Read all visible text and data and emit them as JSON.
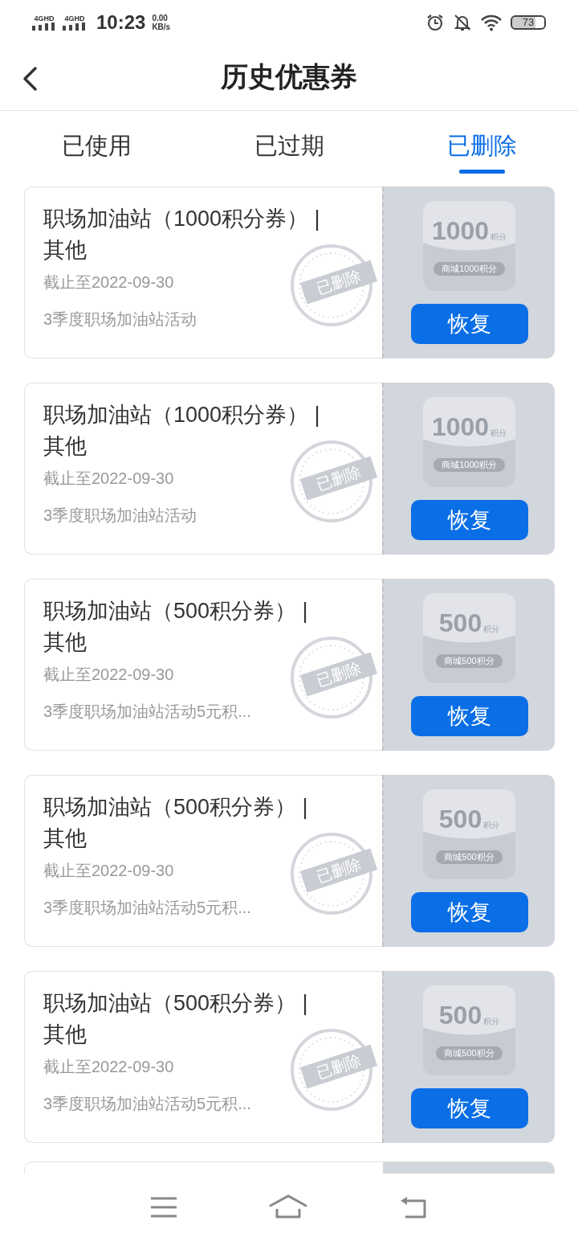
{
  "status_bar": {
    "network_1": "4GHD",
    "network_2": "4GHD",
    "time": "10:23",
    "speed": "0.00",
    "speed_unit": "KB/s",
    "battery": "73"
  },
  "header": {
    "title": "历史优惠券"
  },
  "tabs": [
    {
      "label": "已使用",
      "selected": false
    },
    {
      "label": "已过期",
      "selected": false
    },
    {
      "label": "已删除",
      "selected": true
    }
  ],
  "coupons": [
    {
      "title": "职场加油站（1000积分券） | 其他",
      "expiry": "截止至2022-09-30",
      "description": "3季度职场加油站活动",
      "stamp": "已删除",
      "amount": "1000",
      "unit": "积分",
      "caption": "商城1000积分",
      "button": "恢复"
    },
    {
      "title": "职场加油站（1000积分券） | 其他",
      "expiry": "截止至2022-09-30",
      "description": "3季度职场加油站活动",
      "stamp": "已删除",
      "amount": "1000",
      "unit": "积分",
      "caption": "商城1000积分",
      "button": "恢复"
    },
    {
      "title": "职场加油站（500积分券） | 其他",
      "expiry": "截止至2022-09-30",
      "description": "3季度职场加油站活动5元积...",
      "stamp": "已删除",
      "amount": "500",
      "unit": "积分",
      "caption": "商城500积分",
      "button": "恢复"
    },
    {
      "title": "职场加油站（500积分券） | 其他",
      "expiry": "截止至2022-09-30",
      "description": "3季度职场加油站活动5元积...",
      "stamp": "已删除",
      "amount": "500",
      "unit": "积分",
      "caption": "商城500积分",
      "button": "恢复"
    },
    {
      "title": "职场加油站（500积分券） | 其他",
      "expiry": "截止至2022-09-30",
      "description": "3季度职场加油站活动5元积...",
      "stamp": "已删除",
      "amount": "500",
      "unit": "积分",
      "caption": "商城500积分",
      "button": "恢复"
    }
  ]
}
